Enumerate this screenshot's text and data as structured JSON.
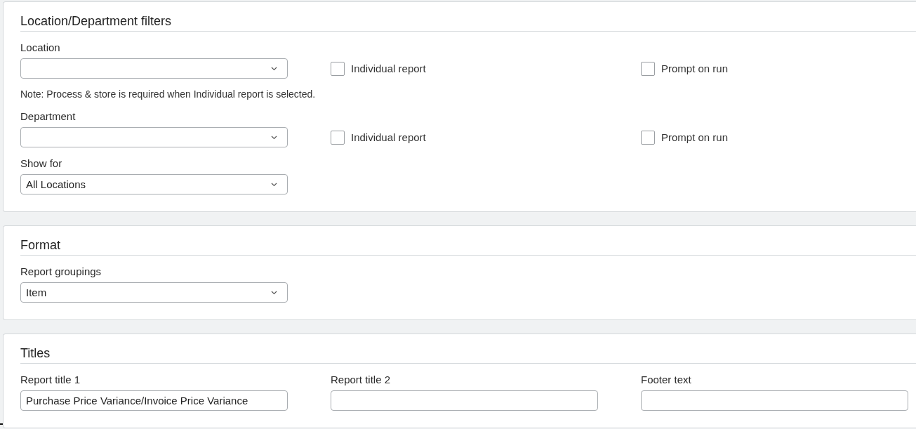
{
  "sections": [
    {
      "title": "Location/Department filters",
      "items": [
        {
          "kind": "select",
          "label": "Location",
          "checkboxes": [
            {
              "label": "Individual report",
              "checked": false
            },
            {
              "label": "Prompt on run",
              "checked": false
            }
          ]
        },
        {
          "kind": "note",
          "text": "Note: Process & store is required when Individual report is selected."
        },
        {
          "kind": "select",
          "label": "Department",
          "checkboxes": [
            {
              "label": "Individual report",
              "checked": false
            },
            {
              "label": "Prompt on run",
              "checked": false
            }
          ]
        },
        {
          "kind": "select",
          "label": "Show for",
          "value": "All Locations"
        }
      ]
    },
    {
      "title": "Format",
      "items": [
        {
          "kind": "select",
          "label": "Report groupings",
          "value": "Item"
        }
      ]
    },
    {
      "title": "Titles",
      "items": [
        {
          "kind": "text-row",
          "fields": [
            {
              "label": "Report title 1",
              "value": "Purchase Price Variance/Invoice Price Variance"
            },
            {
              "label": "Report title 2"
            },
            {
              "label": "Footer text"
            }
          ]
        }
      ]
    }
  ]
}
